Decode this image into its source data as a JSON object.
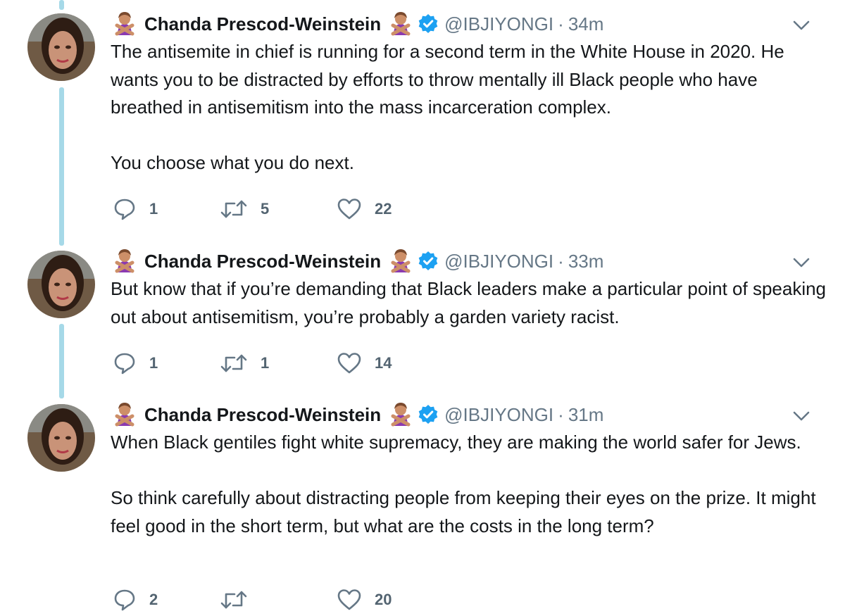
{
  "tweets": [
    {
      "display_name": "Chanda Prescod-Weinstein",
      "handle": "@IBJIYONGI",
      "separator": "·",
      "time": "34m",
      "paragraphs": [
        "The antisemite in chief is running for a second term in the White House in 2020. He wants you to be distracted by efforts to throw mentally ill Black people who have breathed in antisemitism into the mass incarceration complex.",
        "You choose what you do next."
      ],
      "replies": "1",
      "retweets": "5",
      "likes": "22"
    },
    {
      "display_name": "Chanda Prescod-Weinstein",
      "handle": "@IBJIYONGI",
      "separator": "·",
      "time": "33m",
      "paragraphs": [
        "But know that if you’re demanding that Black leaders make a particular point of speaking out about antisemitism, you’re probably a garden variety racist."
      ],
      "replies": "1",
      "retweets": "1",
      "likes": "14"
    },
    {
      "display_name": "Chanda Prescod-Weinstein",
      "handle": "@IBJIYONGI",
      "separator": "·",
      "time": "31m",
      "paragraphs": [
        "When Black gentiles fight white supremacy, they are making the world safer for Jews.",
        "So think carefully about distracting people from keeping their eyes on the prize. It might feel good in the short term, but what are the costs in the long term?"
      ],
      "replies": "2",
      "retweets": "",
      "likes": "20"
    }
  ],
  "icons": {
    "name_emoji": "person-gesturing-no-emoji",
    "verified": "verified-badge-icon",
    "caret": "chevron-down-icon",
    "reply": "reply-icon",
    "retweet": "retweet-icon",
    "like": "heart-icon"
  },
  "colors": {
    "thread_line": "#a6d9e8",
    "verified": "#1da1f2",
    "muted_text": "#657786",
    "action_icon": "#657786",
    "emoji_purple": "#8b3ab0",
    "emoji_skin": "#cd8f68"
  }
}
